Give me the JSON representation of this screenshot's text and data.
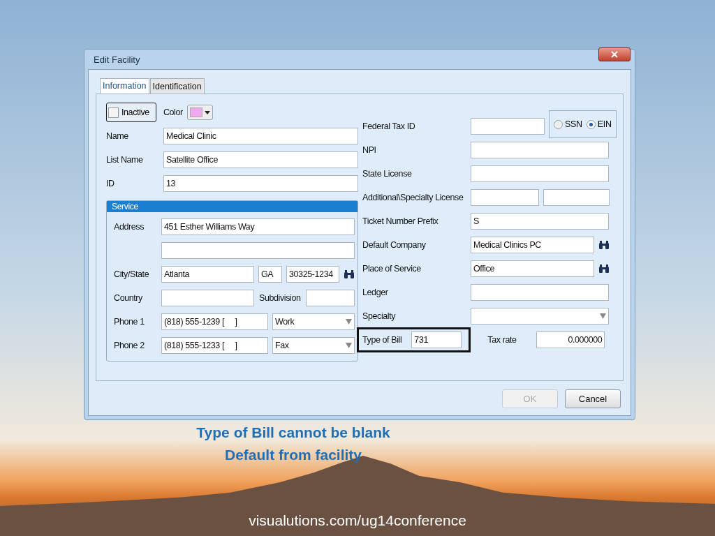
{
  "window": {
    "title": "Edit Facility"
  },
  "tabs": [
    {
      "label": "Information",
      "selected": true
    },
    {
      "label": "Identification",
      "selected": false
    }
  ],
  "inactive": {
    "label": "Inactive",
    "checked": false
  },
  "color_picker": {
    "label": "Color",
    "color": "#f0a8f0"
  },
  "left_fields": [
    {
      "label": "Name",
      "value": "Medical Clinic"
    },
    {
      "label": "List Name",
      "value": "Satellite Office"
    },
    {
      "label": "ID",
      "value": "13"
    }
  ],
  "service": {
    "title": "Service",
    "rows": [
      {
        "kind": "text",
        "label": "Address",
        "value": "451 Esther Williams Way"
      },
      {
        "kind": "text"
      },
      {
        "kind": "city",
        "label": "City/State",
        "city": "Atlanta",
        "state": "GA",
        "zip": "30325-1234"
      },
      {
        "kind": "country",
        "label": "Country",
        "sub_label": "Subdivision"
      },
      {
        "kind": "phone",
        "label": "Phone 1",
        "number": "(818) 555-1239 [     ]",
        "type": "Work"
      },
      {
        "kind": "phone",
        "label": "Phone 2",
        "number": "(818) 555-1233 [     ]",
        "type": "Fax"
      }
    ]
  },
  "right_rows": [
    {
      "kind": "taxid",
      "label": "Federal Tax ID",
      "options": [
        {
          "label": "SSN",
          "selected": false
        },
        {
          "label": "EIN",
          "selected": true
        }
      ]
    },
    {
      "kind": "text",
      "label": "NPI"
    },
    {
      "kind": "text",
      "label": "State License"
    },
    {
      "kind": "split",
      "label": "Additional\\Specialty License"
    },
    {
      "kind": "text",
      "label": "Ticket Number Prefix",
      "value": "S"
    },
    {
      "kind": "lookup",
      "label": "Default Company",
      "value": "Medical Clinics PC"
    },
    {
      "kind": "lookup",
      "label": "Place of Service",
      "value": "Office"
    },
    {
      "kind": "text",
      "label": "Ledger"
    },
    {
      "kind": "dropdown",
      "label": "Specialty"
    },
    {
      "kind": "bill",
      "label": "Type of Bill",
      "value": "731",
      "highlighted": true,
      "extra_label": "Tax rate",
      "extra_value": "0.000000"
    }
  ],
  "buttons": [
    {
      "label": "OK",
      "disabled": true
    },
    {
      "label": "Cancel",
      "disabled": false
    }
  ],
  "slide": {
    "caption_lines": [
      "Type of Bill cannot be blank",
      "Default from facility"
    ],
    "footer_url": "visualutions.com/ug14conference"
  }
}
